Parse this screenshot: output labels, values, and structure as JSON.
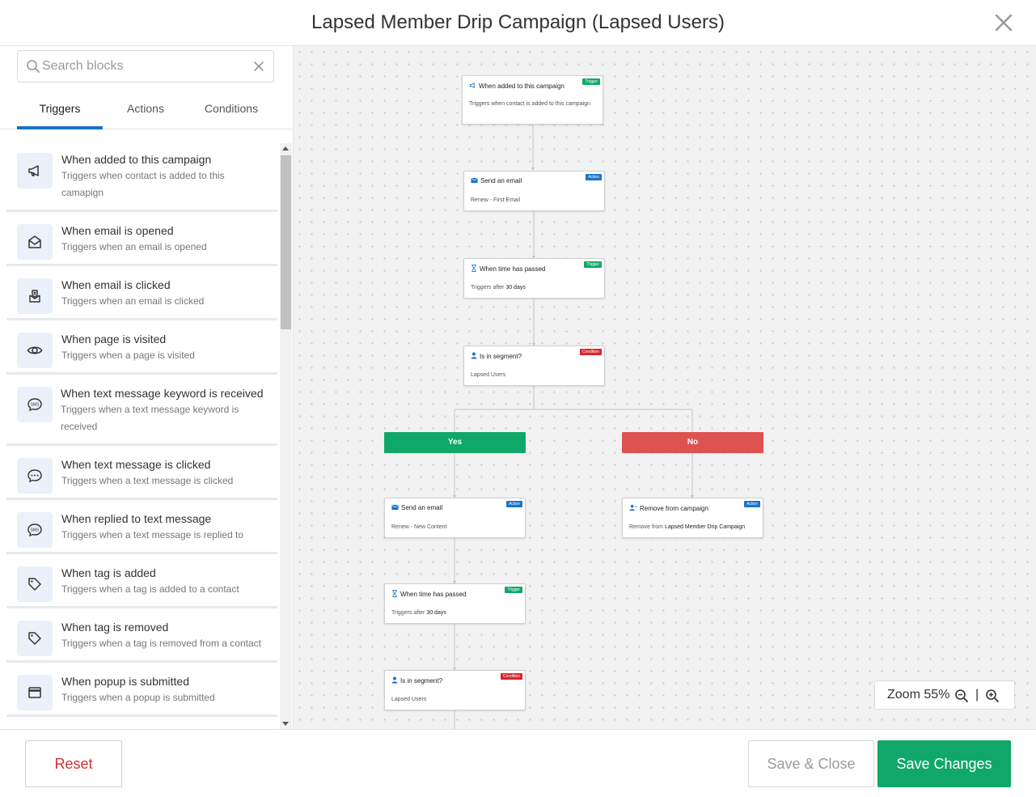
{
  "header": {
    "title": "Lapsed Member Drip Campaign (Lapsed Users)"
  },
  "icons": {
    "close": "close-icon",
    "search": "search-icon",
    "clear": "clear-icon",
    "zoom_out": "zoom-out-icon",
    "zoom_in": "zoom-in-icon"
  },
  "sidebar": {
    "search": {
      "placeholder": "Search blocks",
      "value": ""
    },
    "tabs": [
      {
        "label": "Triggers",
        "active": true
      },
      {
        "label": "Actions",
        "active": false
      },
      {
        "label": "Conditions",
        "active": false
      }
    ],
    "blocks": [
      {
        "title": "When added to this campaign",
        "desc": "Triggers when contact is added to this camapign",
        "icon": "megaphone-icon"
      },
      {
        "title": "When email is opened",
        "desc": "Triggers when an email is opened",
        "icon": "envelope-open-icon"
      },
      {
        "title": "When email is clicked",
        "desc": "Triggers when an email is clicked",
        "icon": "email-click-icon"
      },
      {
        "title": "When page is visited",
        "desc": "Triggers when a page is visited",
        "icon": "eye-icon"
      },
      {
        "title": "When text message keyword is received",
        "desc": "Triggers when a text message keyword is received",
        "icon": "sms-icon"
      },
      {
        "title": "When text message is clicked",
        "desc": "Triggers when a text message is clicked",
        "icon": "chat-icon"
      },
      {
        "title": "When replied to text message",
        "desc": "Triggers when a text message is replied to",
        "icon": "sms-reply-icon"
      },
      {
        "title": "When tag is added",
        "desc": "Triggers when a tag is added to a contact",
        "icon": "tag-icon"
      },
      {
        "title": "When tag is removed",
        "desc": "Triggers when a tag is removed from a contact",
        "icon": "tag-remove-icon"
      },
      {
        "title": "When popup is submitted",
        "desc": "Triggers when a popup is submitted",
        "icon": "popup-icon"
      }
    ]
  },
  "canvas": {
    "nodes": [
      {
        "title": "When added to this campaign",
        "badge": "Trigger",
        "body": "Triggers when contact is added to this campaign",
        "icon": "megaphone-icon"
      },
      {
        "title": "Send an email",
        "badge": "Action",
        "body": "Renew - First Email",
        "icon": "email-icon"
      },
      {
        "title": "When time has passed",
        "badge": "Trigger",
        "body_prefix": "Triggers after",
        "body_value": "30 days",
        "icon": "hourglass-icon"
      },
      {
        "title": "Is in segment?",
        "badge": "Condition",
        "body": "Lapsed Users",
        "icon": "user-icon"
      },
      {
        "title": "Send an email",
        "badge": "Action",
        "body": "Renew - New Content",
        "icon": "email-icon"
      },
      {
        "title": "Remove from campaign",
        "badge": "Action",
        "body_prefix": "Remove from",
        "body_value": "Lapsed Member Drip Campaign",
        "icon": "user-remove-icon"
      },
      {
        "title": "When time has passed",
        "badge": "Trigger",
        "body_prefix": "Triggers after",
        "body_value": "30 days",
        "icon": "hourglass-icon"
      },
      {
        "title": "Is in segment?",
        "badge": "Condition",
        "body": "Lapsed Users",
        "icon": "user-icon"
      }
    ],
    "branches": {
      "yes": "Yes",
      "no": "No"
    },
    "zoom": {
      "label": "Zoom 55%",
      "separator": "|"
    }
  },
  "footer": {
    "reset": "Reset",
    "save_close": "Save & Close",
    "save": "Save Changes"
  },
  "colors": {
    "accent": "#1a73c8",
    "trigger_badge": "#10a868",
    "action_badge": "#1a73c8",
    "condition_badge": "#d8262d",
    "yes": "#10a868",
    "no": "#de524f",
    "save": "#10a868",
    "reset_text": "#d32f2f"
  }
}
